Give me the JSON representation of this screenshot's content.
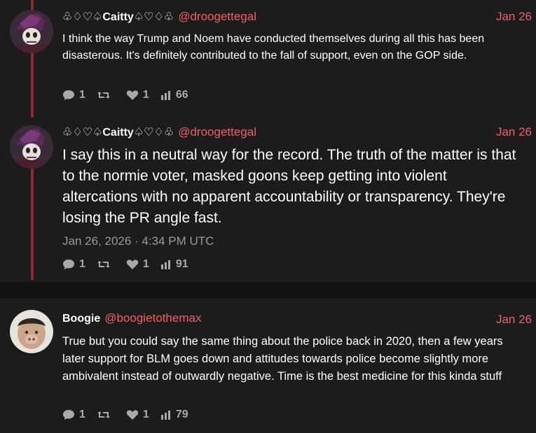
{
  "colors": {
    "background": "#1c1c1c",
    "accent": "#f16060",
    "thread_line": "#8e2a2a",
    "muted": "#a9a9a9"
  },
  "posts": [
    {
      "display_name": "♧♢♡♤Caitty♤♡♢♧",
      "handle": "@droogettegal",
      "date": "Jan 26",
      "text": "I think the way Trump and Noem have conducted themselves during all this has been disasterous. It's definitely contributed to the fall of support, even on the GOP side.",
      "replies": "1",
      "reposts": "",
      "likes": "1",
      "views": "66"
    },
    {
      "display_name": "♧♢♡♤Caitty♤♡♢♧",
      "handle": "@droogettegal",
      "date": "Jan 26",
      "text": "I say this in a neutral way for the record. The truth of the matter is that to the normie voter, masked goons keep getting into violent altercations with no apparent accountability or transparency. They're losing the PR angle fast.",
      "timestamp": "Jan 26, 2026 · 4:34 PM UTC",
      "replies": "1",
      "reposts": "",
      "likes": "1",
      "views": "91"
    },
    {
      "display_name": "Boogie",
      "handle": "@boogietothemax",
      "date": "Jan 26",
      "text": "True but you could say the same thing about the police back in 2020, then a few years later support for BLM goes down and attitudes towards police become slightly more ambivalent instead of outwardly negative. Time is the best medicine for this kinda stuff",
      "replies": "1",
      "reposts": "",
      "likes": "1",
      "views": "79"
    }
  ],
  "icons": {
    "reply": "comment-icon",
    "repost": "retweet-icon",
    "like": "heart-icon",
    "views": "bar-chart-icon"
  }
}
